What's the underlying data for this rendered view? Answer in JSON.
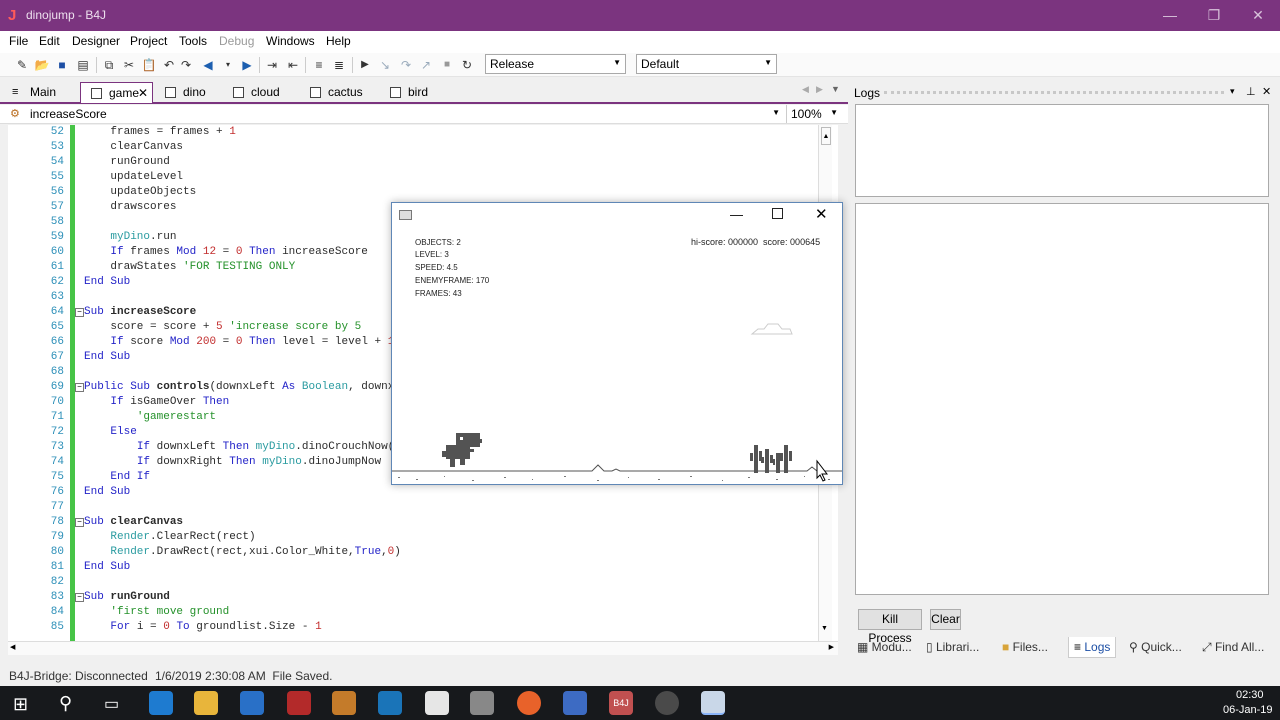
{
  "window": {
    "title": "dinojump - B4J",
    "controls": [
      "—",
      "❐",
      "✕"
    ]
  },
  "menu": [
    "File",
    "Edit",
    "Designer",
    "Project",
    "Tools",
    "Debug",
    "Windows",
    "Help"
  ],
  "toolbar": {
    "build_config": "Release",
    "device": "Default"
  },
  "tabs": [
    {
      "label": "Main"
    },
    {
      "label": "game"
    },
    {
      "label": "dino"
    },
    {
      "label": "cloud"
    },
    {
      "label": "cactus"
    },
    {
      "label": "bird"
    }
  ],
  "editor": {
    "sub_selector": "increaseScore",
    "zoom": "100%",
    "lines": [
      {
        "n": "52",
        "html": "    frames = frames + <span class=\"nm\">1</span>"
      },
      {
        "n": "53",
        "html": "    clearCanvas"
      },
      {
        "n": "54",
        "html": "    runGround"
      },
      {
        "n": "55",
        "html": "    updateLevel"
      },
      {
        "n": "56",
        "html": "    updateObjects"
      },
      {
        "n": "57",
        "html": "    drawscores"
      },
      {
        "n": "58",
        "html": ""
      },
      {
        "n": "59",
        "html": "    <span class=\"ty\">myDino</span>.run"
      },
      {
        "n": "60",
        "html": "    <span class=\"kw\">If</span> frames <span class=\"kw\">Mod</span> <span class=\"nm\">12</span> = <span class=\"nm\">0</span> <span class=\"kw\">Then</span> increaseScore"
      },
      {
        "n": "61",
        "html": "    drawStates <span class=\"cm\">'FOR TESTING ONLY</span>"
      },
      {
        "n": "62",
        "html": "<span class=\"kw\">End Sub</span>"
      },
      {
        "n": "63",
        "html": ""
      },
      {
        "n": "64",
        "fold": true,
        "html": "<span class=\"kw\">Sub</span> <span class=\"bd\">increaseScore</span>"
      },
      {
        "n": "65",
        "html": "    score = score + <span class=\"nm\">5</span> <span class=\"cm\">'increase score by 5</span>"
      },
      {
        "n": "66",
        "html": "    <span class=\"kw\">If</span> score <span class=\"kw\">Mod</span> <span class=\"nm\">200</span> = <span class=\"nm\">0</span> <span class=\"kw\">Then</span> level = level + <span class=\"nm\">1</span>"
      },
      {
        "n": "67",
        "html": "<span class=\"kw\">End Sub</span>"
      },
      {
        "n": "68",
        "html": ""
      },
      {
        "n": "69",
        "fold": true,
        "html": "<span class=\"kw\">Public Sub</span> <span class=\"bd\">controls</span>(downxLeft <span class=\"kw\">As</span> <span class=\"ty\">Boolean</span>, downx"
      },
      {
        "n": "70",
        "html": "    <span class=\"kw\">If</span> isGameOver <span class=\"kw\">Then</span>"
      },
      {
        "n": "71",
        "html": "        <span class=\"cm\">'gamerestart</span>"
      },
      {
        "n": "72",
        "html": "    <span class=\"kw\">Else</span>"
      },
      {
        "n": "73",
        "html": "        <span class=\"kw\">If</span> downxLeft <span class=\"kw\">Then</span> <span class=\"ty\">myDino</span>.dinoCrouchNow("
      },
      {
        "n": "74",
        "html": "        <span class=\"kw\">If</span> downxRight <span class=\"kw\">Then</span> <span class=\"ty\">myDino</span>.dinoJumpNow"
      },
      {
        "n": "75",
        "html": "    <span class=\"kw\">End If</span>"
      },
      {
        "n": "76",
        "html": "<span class=\"kw\">End Sub</span>"
      },
      {
        "n": "77",
        "html": ""
      },
      {
        "n": "78",
        "fold": true,
        "html": "<span class=\"kw\">Sub</span> <span class=\"bd\">clearCanvas</span>"
      },
      {
        "n": "79",
        "html": "    <span class=\"ty\">Render</span>.ClearRect(rect)"
      },
      {
        "n": "80",
        "html": "    <span class=\"ty\">Render</span>.DrawRect(rect,xui.Color_White,<span class=\"kw\">True</span>,<span class=\"nm\">0</span>)"
      },
      {
        "n": "81",
        "html": "<span class=\"kw\">End Sub</span>"
      },
      {
        "n": "82",
        "html": ""
      },
      {
        "n": "83",
        "fold": true,
        "html": "<span class=\"kw\">Sub</span> <span class=\"bd\">runGround</span>"
      },
      {
        "n": "84",
        "html": "    <span class=\"cm\">'first move ground</span>"
      },
      {
        "n": "85",
        "html": "    <span class=\"kw\">For</span> i = <span class=\"nm\">0</span> <span class=\"kw\">To</span> groundlist.Size - <span class=\"nm\">1</span>"
      }
    ]
  },
  "game": {
    "stats": [
      "OBJECTS: 2",
      "LEVEL: 3",
      "SPEED: 4.5",
      "ENEMYFRAME: 170",
      "FRAMES: 43"
    ],
    "score_text": "hi-score: 000000  score: 000645"
  },
  "logs": {
    "title": "Logs",
    "kill_label": "Kill Process",
    "clear_label": "Clear",
    "bottom_tabs": [
      "Modu...",
      "Librari...",
      "Files...",
      "Logs",
      "Quick...",
      "Find All..."
    ]
  },
  "status": {
    "bridge": "B4J-Bridge: Disconnected",
    "message": "1/6/2019 2:30:08 AM  File Saved."
  },
  "taskbar": {
    "time": "02:30",
    "date": "06-Jan-19",
    "b4j_label": "B4J"
  },
  "colors": {
    "accent": "#7b347f",
    "taskbar": "#17191c"
  }
}
